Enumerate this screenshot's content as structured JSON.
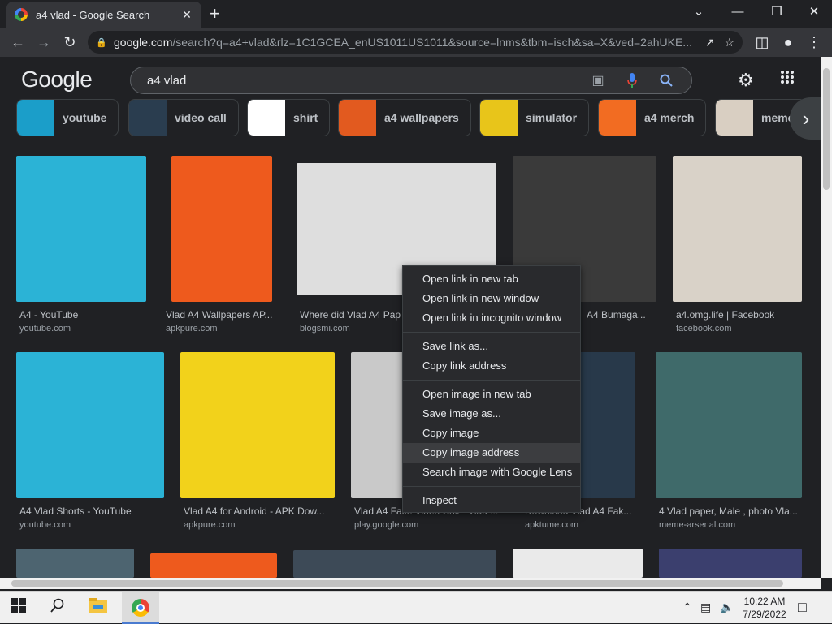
{
  "browser": {
    "tab_title": "a4 vlad - Google Search",
    "tab_close": "✕",
    "new_tab": "+",
    "url_host": "google.com",
    "url_path": "/search?q=a4+vlad&rlz=1C1GCEA_enUS1011US1011&source=lnms&tbm=isch&sa=X&ved=2ahUKE...",
    "window_min": "⌄",
    "window_minimize": "—",
    "window_restore": "❐",
    "window_close": "✕"
  },
  "google": {
    "logo": "Google",
    "query": "a4 vlad"
  },
  "chips": [
    {
      "label": "youtube",
      "color": "#1b9ec9"
    },
    {
      "label": "video call",
      "color": "#2a3d4f"
    },
    {
      "label": "shirt",
      "color": "#ffffff"
    },
    {
      "label": "a4 wallpapers",
      "color": "#e25a1f"
    },
    {
      "label": "simulator",
      "color": "#e8c51a"
    },
    {
      "label": "a4 merch",
      "color": "#f26c22"
    },
    {
      "label": "meme",
      "color": "#d9cfc2"
    }
  ],
  "row1": [
    {
      "title": "A4 - YouTube",
      "source": "youtube.com",
      "color": "#2bb3d6"
    },
    {
      "title": "Vlad A4 Wallpapers AP...",
      "source": "apkpure.com",
      "color": "#ee5a1d"
    },
    {
      "title": "Where did Vlad A4 Pap...",
      "source": "blogsmi.com",
      "color": "#dedede"
    },
    {
      "title": "A4 Bumaga...",
      "source": "",
      "color": "#3a3a3a"
    },
    {
      "title": "a4.omg.life | Facebook",
      "source": "facebook.com",
      "color": "#d9d2c8"
    }
  ],
  "row2": [
    {
      "title": "A4 Vlad Shorts - YouTube",
      "source": "youtube.com",
      "color": "#2bb3d6"
    },
    {
      "title": "Vlad A4 for Android - APK Dow...",
      "source": "apkpure.com",
      "color": "#f2d21b"
    },
    {
      "title": "Vlad A4 Fake Video Call - Vlad ...",
      "source": "play.google.com",
      "color": "#c9c9c9"
    },
    {
      "title": "Download Vlad A4 Fak...",
      "source": "apktume.com",
      "color": "#28394a"
    },
    {
      "title": "4 Vlad paper, Male , photo Vla...",
      "source": "meme-arsenal.com",
      "color": "#3f6a6a"
    }
  ],
  "context_menu": {
    "open_link_tab": "Open link in new tab",
    "open_link_window": "Open link in new window",
    "open_link_incognito": "Open link in incognito window",
    "save_link": "Save link as...",
    "copy_link": "Copy link address",
    "open_image_tab": "Open image in new tab",
    "save_image": "Save image as...",
    "copy_image": "Copy image",
    "copy_image_address": "Copy image address",
    "search_lens": "Search image with Google Lens",
    "inspect": "Inspect"
  },
  "taskbar": {
    "time": "10:22 AM",
    "date": "7/29/2022"
  }
}
